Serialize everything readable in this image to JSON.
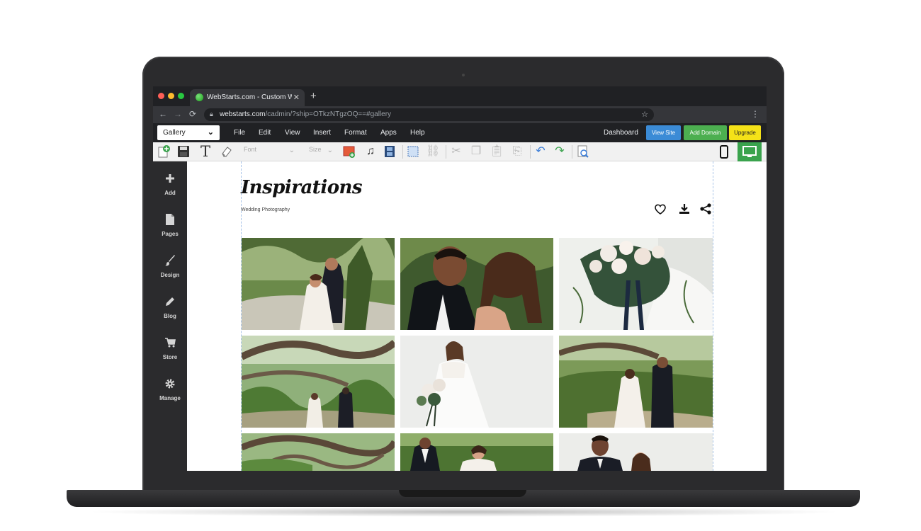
{
  "browser": {
    "tab_title": "WebStarts.com - Custom Web",
    "tab_close": "✕",
    "new_tab": "+",
    "url_host": "webstarts.com",
    "url_path": "/cadmin/?ship=OTkzNTgzOQ==#gallery"
  },
  "menubar": {
    "page_select": "Gallery",
    "items": [
      "File",
      "Edit",
      "View",
      "Insert",
      "Format",
      "Apps",
      "Help"
    ],
    "dashboard": "Dashboard",
    "view_site": "View Site",
    "add_domain": "Add Domain",
    "upgrade": "Upgrade"
  },
  "toolbar": {
    "font_placeholder": "Font",
    "size_placeholder": "Size"
  },
  "sidebar": {
    "items": [
      {
        "label": "Add",
        "icon": "plus-icon"
      },
      {
        "label": "Pages",
        "icon": "page-icon"
      },
      {
        "label": "Design",
        "icon": "brush-icon"
      },
      {
        "label": "Blog",
        "icon": "pencil-icon"
      },
      {
        "label": "Store",
        "icon": "cart-icon"
      },
      {
        "label": "Manage",
        "icon": "gear-icon"
      }
    ]
  },
  "site": {
    "title": "Inspirations",
    "subtitle": "Wedding Photography"
  },
  "gallery": {
    "photos": [
      "couple-embrace-forest",
      "couple-closeup-kiss",
      "bridal-bouquet",
      "couple-walking-oak-trees",
      "bride-with-bouquet",
      "couple-holding-hands-forest",
      "oak-branches",
      "couple-seated-garden",
      "groom-and-bride-portrait"
    ]
  },
  "colors": {
    "view_site": "#3b8bd6",
    "add_domain": "#4caf50",
    "upgrade": "#f5e218",
    "desktop_active": "#3aa34d"
  }
}
